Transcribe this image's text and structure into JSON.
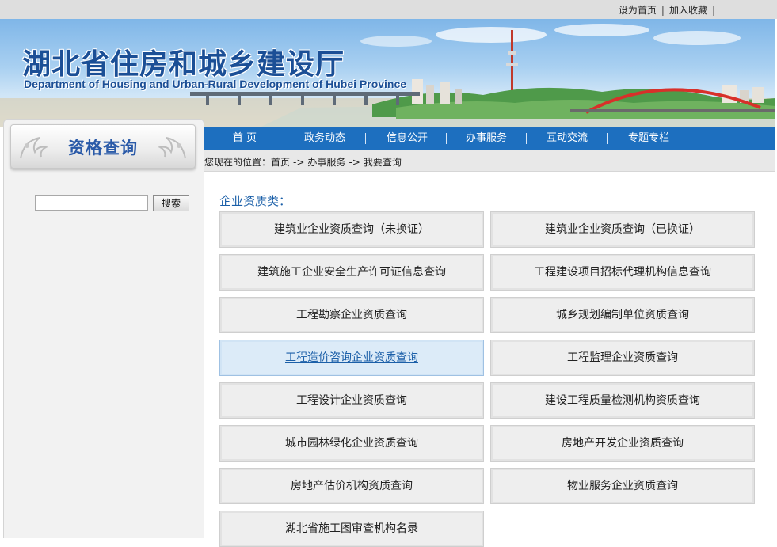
{
  "topbar": {
    "set_home": "设为首页",
    "add_favorite": "加入收藏",
    "separator": "|"
  },
  "banner": {
    "title_cn": "湖北省住房和城乡建设厅",
    "title_en": "Department of Housing and Urban-Rural Development of Hubei Province"
  },
  "sidebar": {
    "heading": "资格查询",
    "search_value": "",
    "search_button": "搜索"
  },
  "nav": {
    "items": [
      {
        "label": "首 页"
      },
      {
        "label": "政务动态"
      },
      {
        "label": "信息公开"
      },
      {
        "label": "办事服务"
      },
      {
        "label": "互动交流"
      },
      {
        "label": "专题专栏"
      }
    ]
  },
  "breadcrumb": {
    "prefix": "您现在的位置：",
    "items": [
      "首页",
      "办事服务",
      "我要查询"
    ],
    "arrow": "->"
  },
  "content": {
    "section_title": "企业资质类：",
    "queries": [
      {
        "label": "建筑业企业资质查询（未换证）"
      },
      {
        "label": "建筑业企业资质查询（已换证）"
      },
      {
        "label": "建筑施工企业安全生产许可证信息查询"
      },
      {
        "label": "工程建设项目招标代理机构信息查询"
      },
      {
        "label": "工程勘察企业资质查询"
      },
      {
        "label": "城乡规划编制单位资质查询"
      },
      {
        "label": "工程造价咨询企业资质查询",
        "active": true
      },
      {
        "label": "工程监理企业资质查询"
      },
      {
        "label": "工程设计企业资质查询"
      },
      {
        "label": "建设工程质量检测机构资质查询"
      },
      {
        "label": "城市园林绿化企业资质查询"
      },
      {
        "label": "房地产开发企业资质查询"
      },
      {
        "label": "房地产估价机构资质查询"
      },
      {
        "label": "物业服务企业资质查询"
      },
      {
        "label": "湖北省施工图审查机构名录"
      }
    ]
  },
  "colors": {
    "nav_blue": "#1d6fbf",
    "title_blue": "#1b4f96",
    "section_blue": "#1a5fa8",
    "active_bg": "#dcebf8"
  }
}
